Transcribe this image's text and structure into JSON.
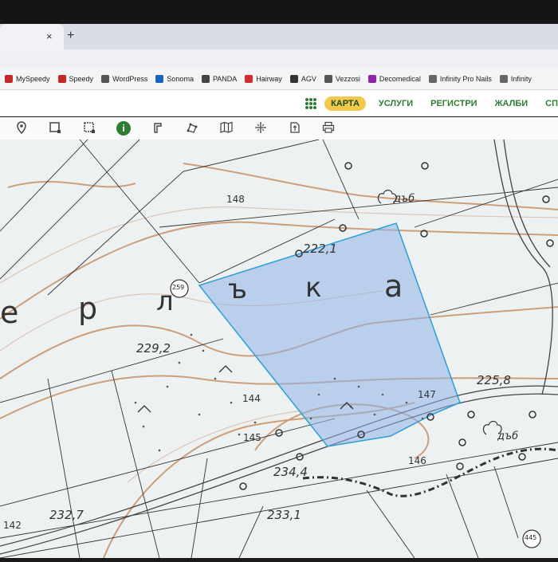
{
  "browser": {
    "tab_close": "×",
    "new_tab": "+",
    "bookmarks": [
      {
        "label": "MySpeedy",
        "color": "#c62828"
      },
      {
        "label": "Speedy",
        "color": "#c62828"
      },
      {
        "label": "WordPress",
        "color": "#555"
      },
      {
        "label": "Sonoma",
        "color": "#1565c0"
      },
      {
        "label": "PANDA",
        "color": "#444"
      },
      {
        "label": "Hairway",
        "color": "#d32f2f"
      },
      {
        "label": "AGV",
        "color": "#333"
      },
      {
        "label": "Vezzosi",
        "color": "#555"
      },
      {
        "label": "Decomedical",
        "color": "#8e24aa"
      },
      {
        "label": "Infinity Pro Nails",
        "color": "#666"
      },
      {
        "label": "Infinity",
        "color": "#666"
      }
    ]
  },
  "site_nav": {
    "items": [
      "КАРТА",
      "УСЛУГИ",
      "РЕГИСТРИ",
      "ЖАЛБИ",
      "СП"
    ],
    "active": "КАРТА",
    "accent": "#2e7d32",
    "active_bg": "#f2c94c"
  },
  "toolbar": {
    "tools": [
      "location-pin-icon",
      "select-rect-icon",
      "select-poly-icon",
      "info-icon",
      "measure-icon",
      "draw-polygon-icon",
      "map-layers-icon",
      "crosshair-icon",
      "export-icon",
      "print-icon"
    ],
    "info_label": "i"
  },
  "map": {
    "letters": [
      "е",
      "р",
      "л",
      "ъ",
      "к",
      "а"
    ],
    "elevations": [
      "222,1",
      "229,2",
      "225,8",
      "234,4",
      "233,1",
      "232,7"
    ],
    "parcels": [
      "148",
      "144",
      "145",
      "147",
      "146",
      "142"
    ],
    "markers": [
      "259",
      "445"
    ],
    "labels": [
      "дъб",
      "дъб"
    ],
    "selection_color": "#8fb2e8"
  }
}
